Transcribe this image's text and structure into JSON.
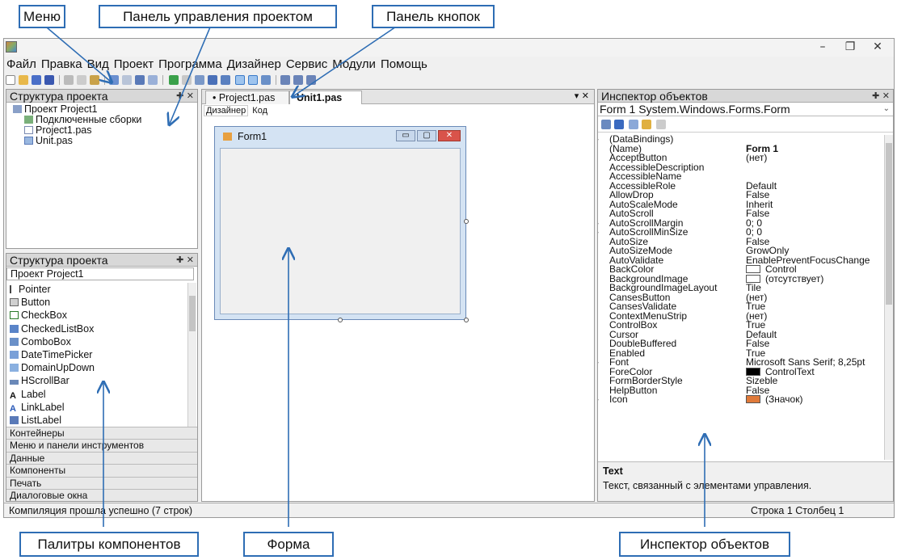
{
  "callouts": {
    "menu": "Меню",
    "project_panel": "Панель управления проектом",
    "buttons_panel": "Панель кнопок",
    "palettes": "Палитры компонентов",
    "form": "Форма",
    "inspector": "Инспектор объектов"
  },
  "window": {
    "minimize": "–",
    "restore": "❐",
    "close": "✕"
  },
  "menu": [
    "Файл",
    "Правка",
    "Вид",
    "Проект",
    "Программа",
    "Дизайнер",
    "Сервис",
    "Модули",
    "Помощь"
  ],
  "project_structure": {
    "title": "Структура проекта",
    "root": "Проект Project1",
    "items": [
      "Подключенные сборки",
      "Project1.pas",
      "Unit.pas"
    ]
  },
  "palette": {
    "title": "Структура проекта",
    "subtitle": "Проект Project1",
    "items": [
      "Pointer",
      "Button",
      "CheckBox",
      "CheckedListBox",
      "ComboBox",
      "DateTimePicker",
      "DomainUpDown",
      "HScrollBar",
      "Label",
      "LinkLabel",
      "ListLabel"
    ],
    "categories": [
      "Контейнеры",
      "Меню и панели инструментов",
      "Данные",
      "Компоненты",
      "Печать",
      "Диалоговые окна"
    ]
  },
  "editor": {
    "tabs": [
      "• Project1.pas",
      "Unit1.pas"
    ],
    "subtabs": [
      "Дизайнер",
      "Код"
    ],
    "form_title": "Form1"
  },
  "inspector": {
    "title": "Инспектор объектов",
    "object": "Form 1  System.Windows.Forms.Form",
    "properties": [
      {
        "name": "(DataBindings)",
        "value": "",
        "expand": true
      },
      {
        "name": "(Name)",
        "value": "Form 1",
        "bold": true
      },
      {
        "name": "AcceptButton",
        "value": "(нет)"
      },
      {
        "name": "AccessibleDescription",
        "value": ""
      },
      {
        "name": "AccessibleName",
        "value": ""
      },
      {
        "name": "AccessibleRole",
        "value": "Default"
      },
      {
        "name": "AllowDrop",
        "value": "False"
      },
      {
        "name": "AutoScaleMode",
        "value": "Inherit"
      },
      {
        "name": "AutoScroll",
        "value": "False"
      },
      {
        "name": "AutoScrollMargin",
        "value": "0; 0",
        "expand": true
      },
      {
        "name": "AutoScrollMinSize",
        "value": "0; 0",
        "expand": true
      },
      {
        "name": "AutoSize",
        "value": "False"
      },
      {
        "name": "AutoSizeMode",
        "value": "GrowOnly"
      },
      {
        "name": "AutoValidate",
        "value": "EnablePreventFocusChange"
      },
      {
        "name": "BackColor",
        "value": "Control",
        "swatch": "#ffffff"
      },
      {
        "name": "BackgroundImage",
        "value": "(отсутствует)",
        "swatch": "#ffffff"
      },
      {
        "name": "BackgroundImageLayout",
        "value": "Tile"
      },
      {
        "name": "CansesButton",
        "value": "(нет)"
      },
      {
        "name": "CansesValidate",
        "value": "True"
      },
      {
        "name": "ContextMenuStrip",
        "value": "(нет)"
      },
      {
        "name": "ControlBox",
        "value": "True"
      },
      {
        "name": "Cursor",
        "value": "Default"
      },
      {
        "name": "DoubleBuffered",
        "value": "False"
      },
      {
        "name": "Enabled",
        "value": "True"
      },
      {
        "name": "Font",
        "value": "Microsoft Sans Serif; 8,25pt",
        "expand": true
      },
      {
        "name": "ForeColor",
        "value": "ControlText",
        "swatch": "#000000"
      },
      {
        "name": "FormBorderStyle",
        "value": "Sizeble"
      },
      {
        "name": "HelpButton",
        "value": "False"
      },
      {
        "name": "Icon",
        "value": "(Значок)",
        "swatch": "#e07a3a",
        "expand": true
      }
    ],
    "help_title": "Text",
    "help_text": "Текст, связанный с элементами управления."
  },
  "status": {
    "left": "Компиляция прошла успешно (7 строк)",
    "right": "Строка  1  Столбец  1"
  },
  "colors": {
    "callout_border": "#2e6db4",
    "arrow": "#2e6db4",
    "form_caption": "#d4e3f3"
  }
}
